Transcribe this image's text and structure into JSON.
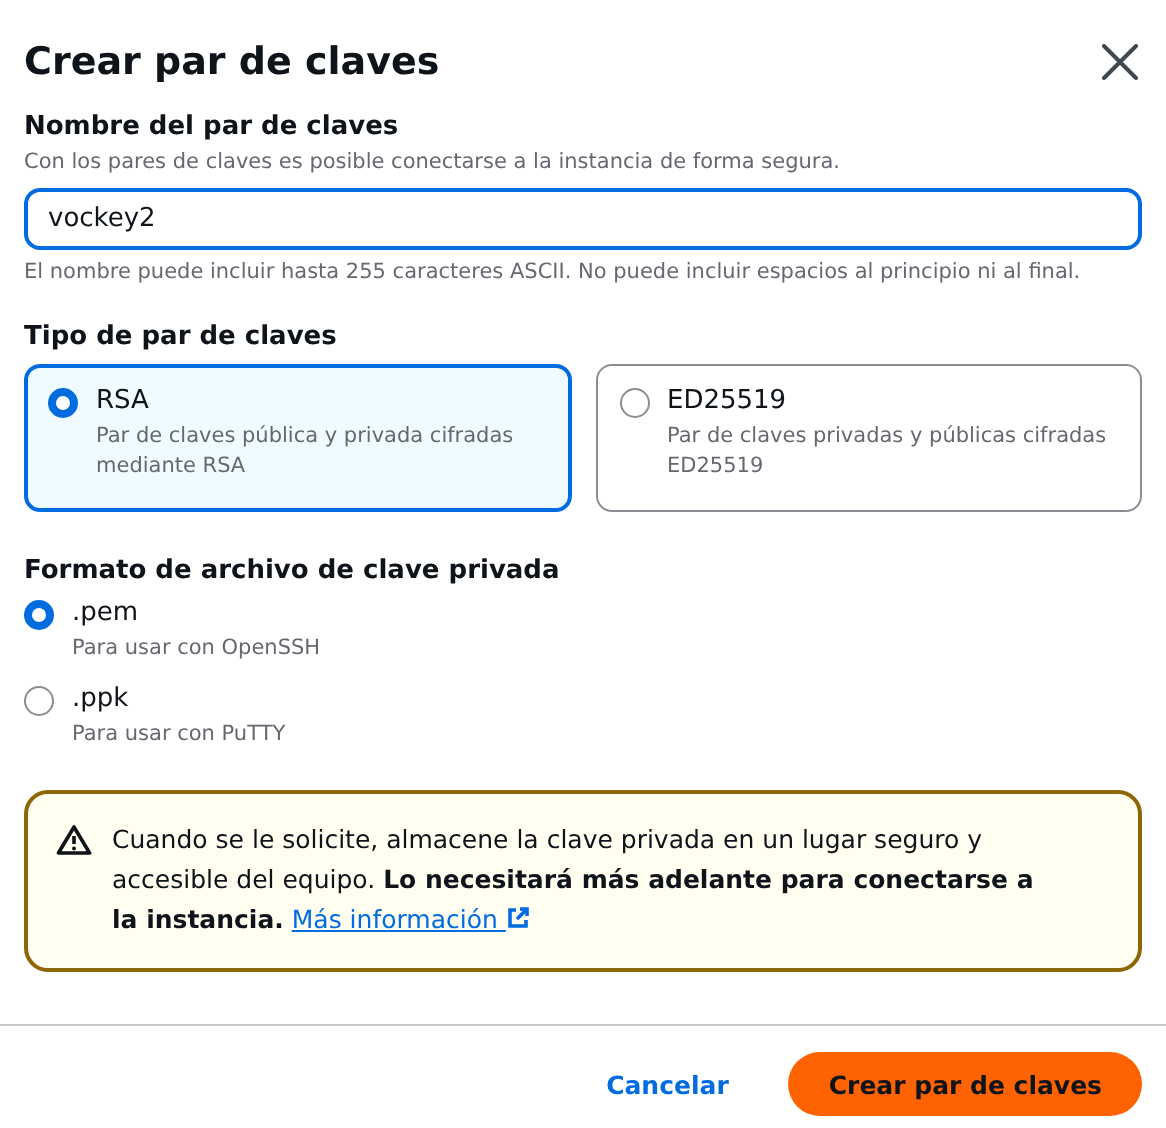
{
  "dialog": {
    "title": "Crear par de claves"
  },
  "name_field": {
    "label": "Nombre del par de claves",
    "description": "Con los pares de claves es posible conectarse a la instancia de forma segura.",
    "value": "vockey2",
    "focused": true,
    "hint": "El nombre puede incluir hasta 255 caracteres ASCII. No puede incluir espacios al principio ni al final."
  },
  "key_type": {
    "label": "Tipo de par de claves",
    "options": [
      {
        "title": "RSA",
        "description": "Par de claves pública y privada cifradas mediante RSA",
        "selected": true
      },
      {
        "title": "ED25519",
        "description": "Par de claves privadas y públicas cifradas ED25519",
        "selected": false
      }
    ]
  },
  "file_format": {
    "label": "Formato de archivo de clave privada",
    "options": [
      {
        "title": ".pem",
        "description": "Para usar con OpenSSH",
        "selected": true
      },
      {
        "title": ".ppk",
        "description": "Para usar con PuTTY",
        "selected": false
      }
    ]
  },
  "warning": {
    "text": "Cuando se le solicite, almacene la clave privada en un lugar seguro y accesible del equipo. **Lo necesitará más adelante para conectarse a la instancia.**",
    "link": "Más información"
  },
  "buttons": [
    {
      "label": "Cancelar",
      "kind": "link"
    },
    {
      "label": "Crear par de claves",
      "kind": "primary"
    }
  ]
}
